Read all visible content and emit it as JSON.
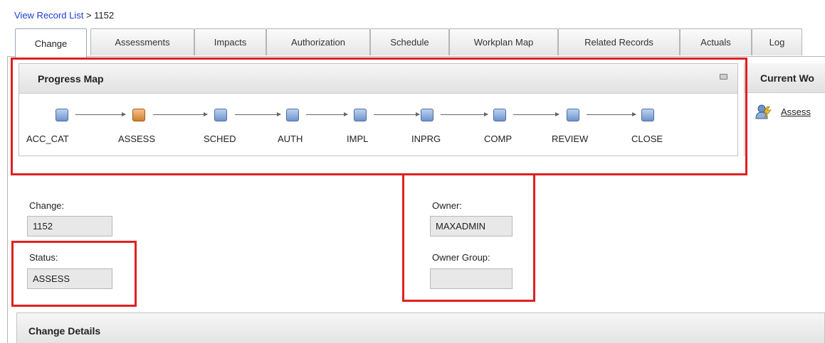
{
  "breadcrumb": {
    "link": "View Record List",
    "separator": " > ",
    "current": "1152"
  },
  "tabs": [
    {
      "label": "Change",
      "active": true
    },
    {
      "label": "Assessments",
      "active": false
    },
    {
      "label": "Impacts",
      "active": false
    },
    {
      "label": "Authorization",
      "active": false
    },
    {
      "label": "Schedule",
      "active": false
    },
    {
      "label": "Workplan Map",
      "active": false
    },
    {
      "label": "Related Records",
      "active": false
    },
    {
      "label": "Actuals",
      "active": false
    },
    {
      "label": "Log",
      "active": false
    }
  ],
  "progress_map": {
    "title": "Progress Map",
    "minimize_icon": "minimize-icon",
    "current_step": "ASSESS",
    "steps": [
      "ACC_CAT",
      "ASSESS",
      "SCHED",
      "AUTH",
      "IMPL",
      "INPRG",
      "COMP",
      "REVIEW",
      "CLOSE"
    ]
  },
  "current_work": {
    "title": "Current Wo",
    "icon": "assign-user-icon",
    "link": "Assess"
  },
  "fields": {
    "change": {
      "label": "Change:",
      "value": "1152"
    },
    "status": {
      "label": "Status:",
      "value": "ASSESS"
    },
    "owner": {
      "label": "Owner:",
      "value": "MAXADMIN"
    },
    "owner_group": {
      "label": "Owner Group:",
      "value": ""
    }
  },
  "details": {
    "title": "Change Details"
  },
  "colors": {
    "highlight": "#e02020",
    "step": "#6f93cc",
    "current_step": "#d1802c",
    "link": "#1a3fd6"
  }
}
